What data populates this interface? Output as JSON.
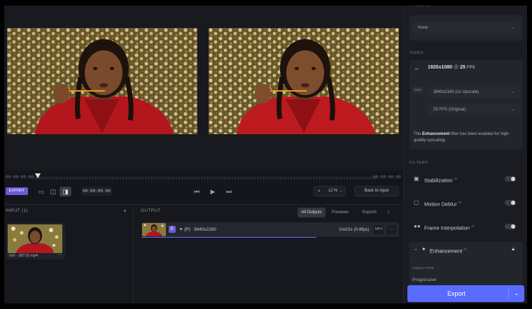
{
  "timeline": {
    "start_time": "00:00:00:00",
    "end_time": "00:00:00:00",
    "export_tag": "EXPORT",
    "timecode": "00:00:00:00",
    "zoom_value": "12",
    "zoom_unit": "%",
    "back_to_input": "Back to input"
  },
  "input": {
    "title": "INPUT (1)",
    "add": "+",
    "file_name": "Girl - 38719.mp4",
    "more": "···"
  },
  "output": {
    "title": "OUTPUT",
    "tabs": [
      {
        "label": "All Outputs",
        "selected": true
      },
      {
        "label": "Previews",
        "selected": false
      },
      {
        "label": "Exports",
        "selected": false
      }
    ],
    "row": {
      "badge": "E",
      "model": "(P)",
      "resolution": "3840x2160",
      "duration": "1m22s (0.8fps)",
      "mini_label": "MP4",
      "more": "···"
    }
  },
  "sidebar": {
    "presets_label": "PRESETS",
    "preset_value": "None",
    "video_label": "VIDEO",
    "in_tag": "IN",
    "in_resolution": "1920x1080",
    "in_at": "@",
    "in_fps": "25",
    "in_fps_unit": "FPS",
    "out_tag": "OUT",
    "out_resolution": "3840x2160 (2x Upscale)",
    "out_fps": "25 FPS (Original)",
    "note_prefix": "The",
    "note_bold": "Enhancement",
    "note_rest": "filter has been enabled for high-quality upscaling.",
    "filters_label": "FILTERS",
    "filters": [
      {
        "label": "Stabilization",
        "ai": "AI"
      },
      {
        "label": "Motion Deblur",
        "ai": "AI"
      },
      {
        "label": "Frame Interpolation",
        "ai": "AI"
      }
    ],
    "enhancement_label": "Enhancement",
    "enhancement_ai": "AI",
    "video_type_label": "VIDEO TYPE",
    "video_type_value": "Progressive",
    "export_label": "Export"
  },
  "colors": {
    "accent": "#5a6bff",
    "tag_purple": "#6b5bd6"
  }
}
